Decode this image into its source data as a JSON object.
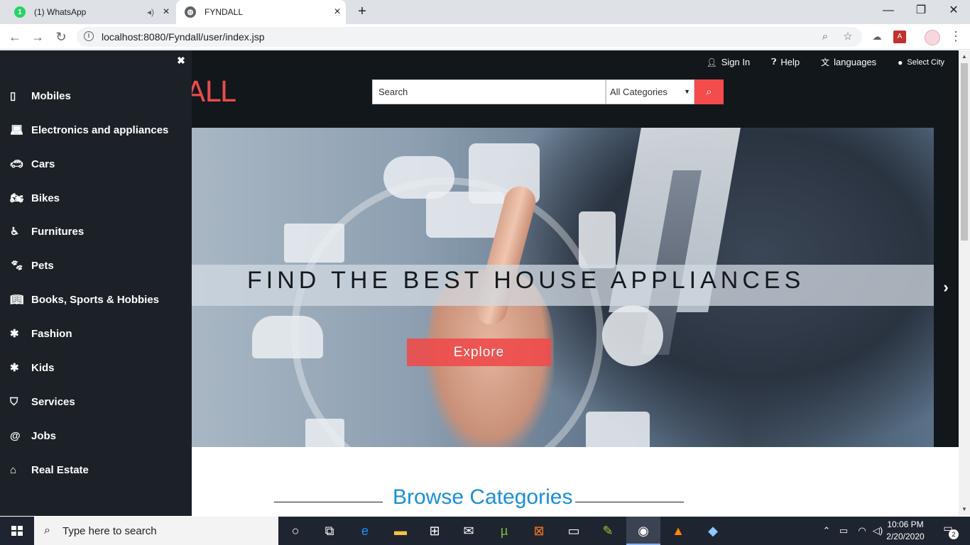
{
  "browser": {
    "tabs": [
      {
        "title": "(1) WhatsApp",
        "badge": "1"
      },
      {
        "title": "FYNDALL"
      }
    ],
    "url": "localhost:8080/Fyndall/user/index.jsp"
  },
  "header": {
    "logo_visible": "ALL",
    "links": {
      "sign_in": "Sign In",
      "help": "Help",
      "languages": "languages",
      "select_city": "Select City"
    },
    "search": {
      "placeholder": "Search",
      "category": "All Categories"
    }
  },
  "sidebar": {
    "items": [
      {
        "label": "Mobiles",
        "icon": "mobile-icon"
      },
      {
        "label": "Electronics and appliances",
        "icon": "laptop-icon"
      },
      {
        "label": "Cars",
        "icon": "car-icon"
      },
      {
        "label": "Bikes",
        "icon": "motorcycle-icon"
      },
      {
        "label": "Furnitures",
        "icon": "wheelchair-icon"
      },
      {
        "label": "Pets",
        "icon": "paw-icon"
      },
      {
        "label": "Books, Sports & Hobbies",
        "icon": "book-icon"
      },
      {
        "label": "Fashion",
        "icon": "asterisk-icon"
      },
      {
        "label": "Kids",
        "icon": "asterisk-icon"
      },
      {
        "label": "Services",
        "icon": "shield-icon"
      },
      {
        "label": "Jobs",
        "icon": "at-icon"
      },
      {
        "label": "Real Estate",
        "icon": "home-icon"
      }
    ]
  },
  "hero": {
    "headline": "FIND THE BEST HOUSE APPLIANCES",
    "cta": "Explore"
  },
  "browse": {
    "title": "Browse Categories"
  },
  "taskbar": {
    "search_placeholder": "Type here to search",
    "time": "10:06 PM",
    "date": "2/20/2020",
    "notification_count": "2"
  },
  "colors": {
    "accent_red": "#f44c4c",
    "header_bg": "#12171c",
    "sidebar_bg": "#1b2127",
    "browse_blue": "#1a8fd6"
  }
}
